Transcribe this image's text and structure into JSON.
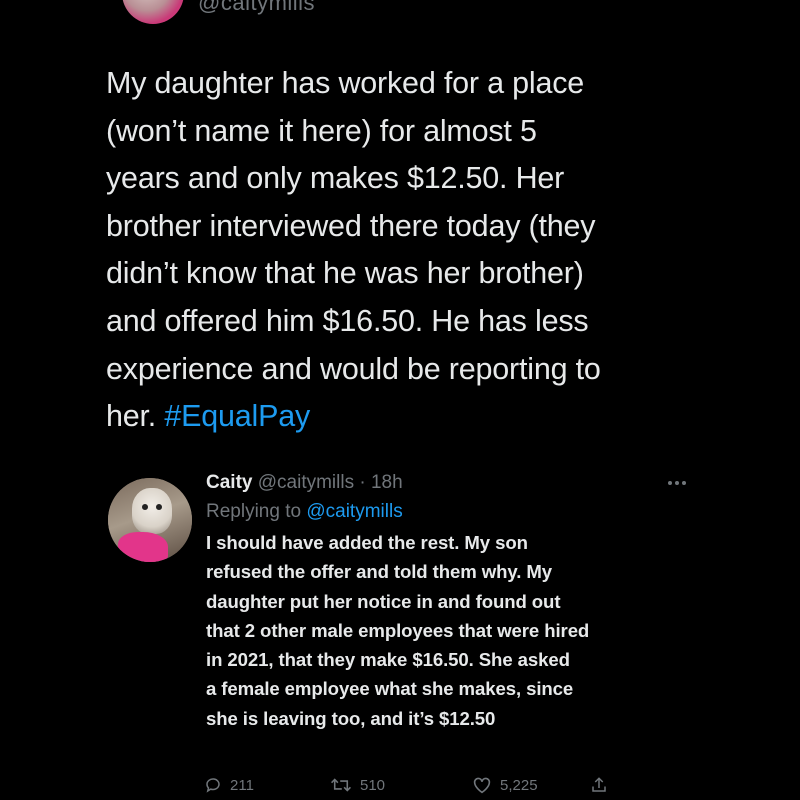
{
  "top": {
    "handle_fragment": "@caitymills"
  },
  "tweet": {
    "text_lines": [
      "My daughter has worked for a place",
      "(won’t name it here) for almost 5",
      "years and only makes $12.50. Her",
      "brother interviewed there today (they",
      "didn’t know that he was her brother)",
      "and offered him $16.50. He has less",
      "experience and would be reporting to"
    ],
    "last_line_prefix": "her. ",
    "hashtag": "#EqualPay"
  },
  "reply": {
    "name": "Caity",
    "handle_time": "@caitymills · 18h",
    "replying_label": "Replying to ",
    "replying_mention": "@caitymills",
    "text_lines": [
      "I should have added the rest. My son",
      "refused the offer and told them why. My",
      "daughter put her notice in and found out",
      "that 2 other male employees that were hired",
      "in 2021, that they make $16.50. She asked",
      "a female employee what she makes, since",
      "she is leaving too, and it’s $12.50"
    ]
  },
  "actions": {
    "replies": "211",
    "retweets": "510",
    "likes": "5,225"
  },
  "colors": {
    "background": "#000000",
    "text": "#e7e9ea",
    "muted": "#71767b",
    "accent": "#1d9bf0",
    "avatar_pink": "#e2358a"
  },
  "icons": [
    "more-horizontal-icon",
    "reply-icon",
    "retweet-icon",
    "like-icon",
    "share-icon"
  ]
}
